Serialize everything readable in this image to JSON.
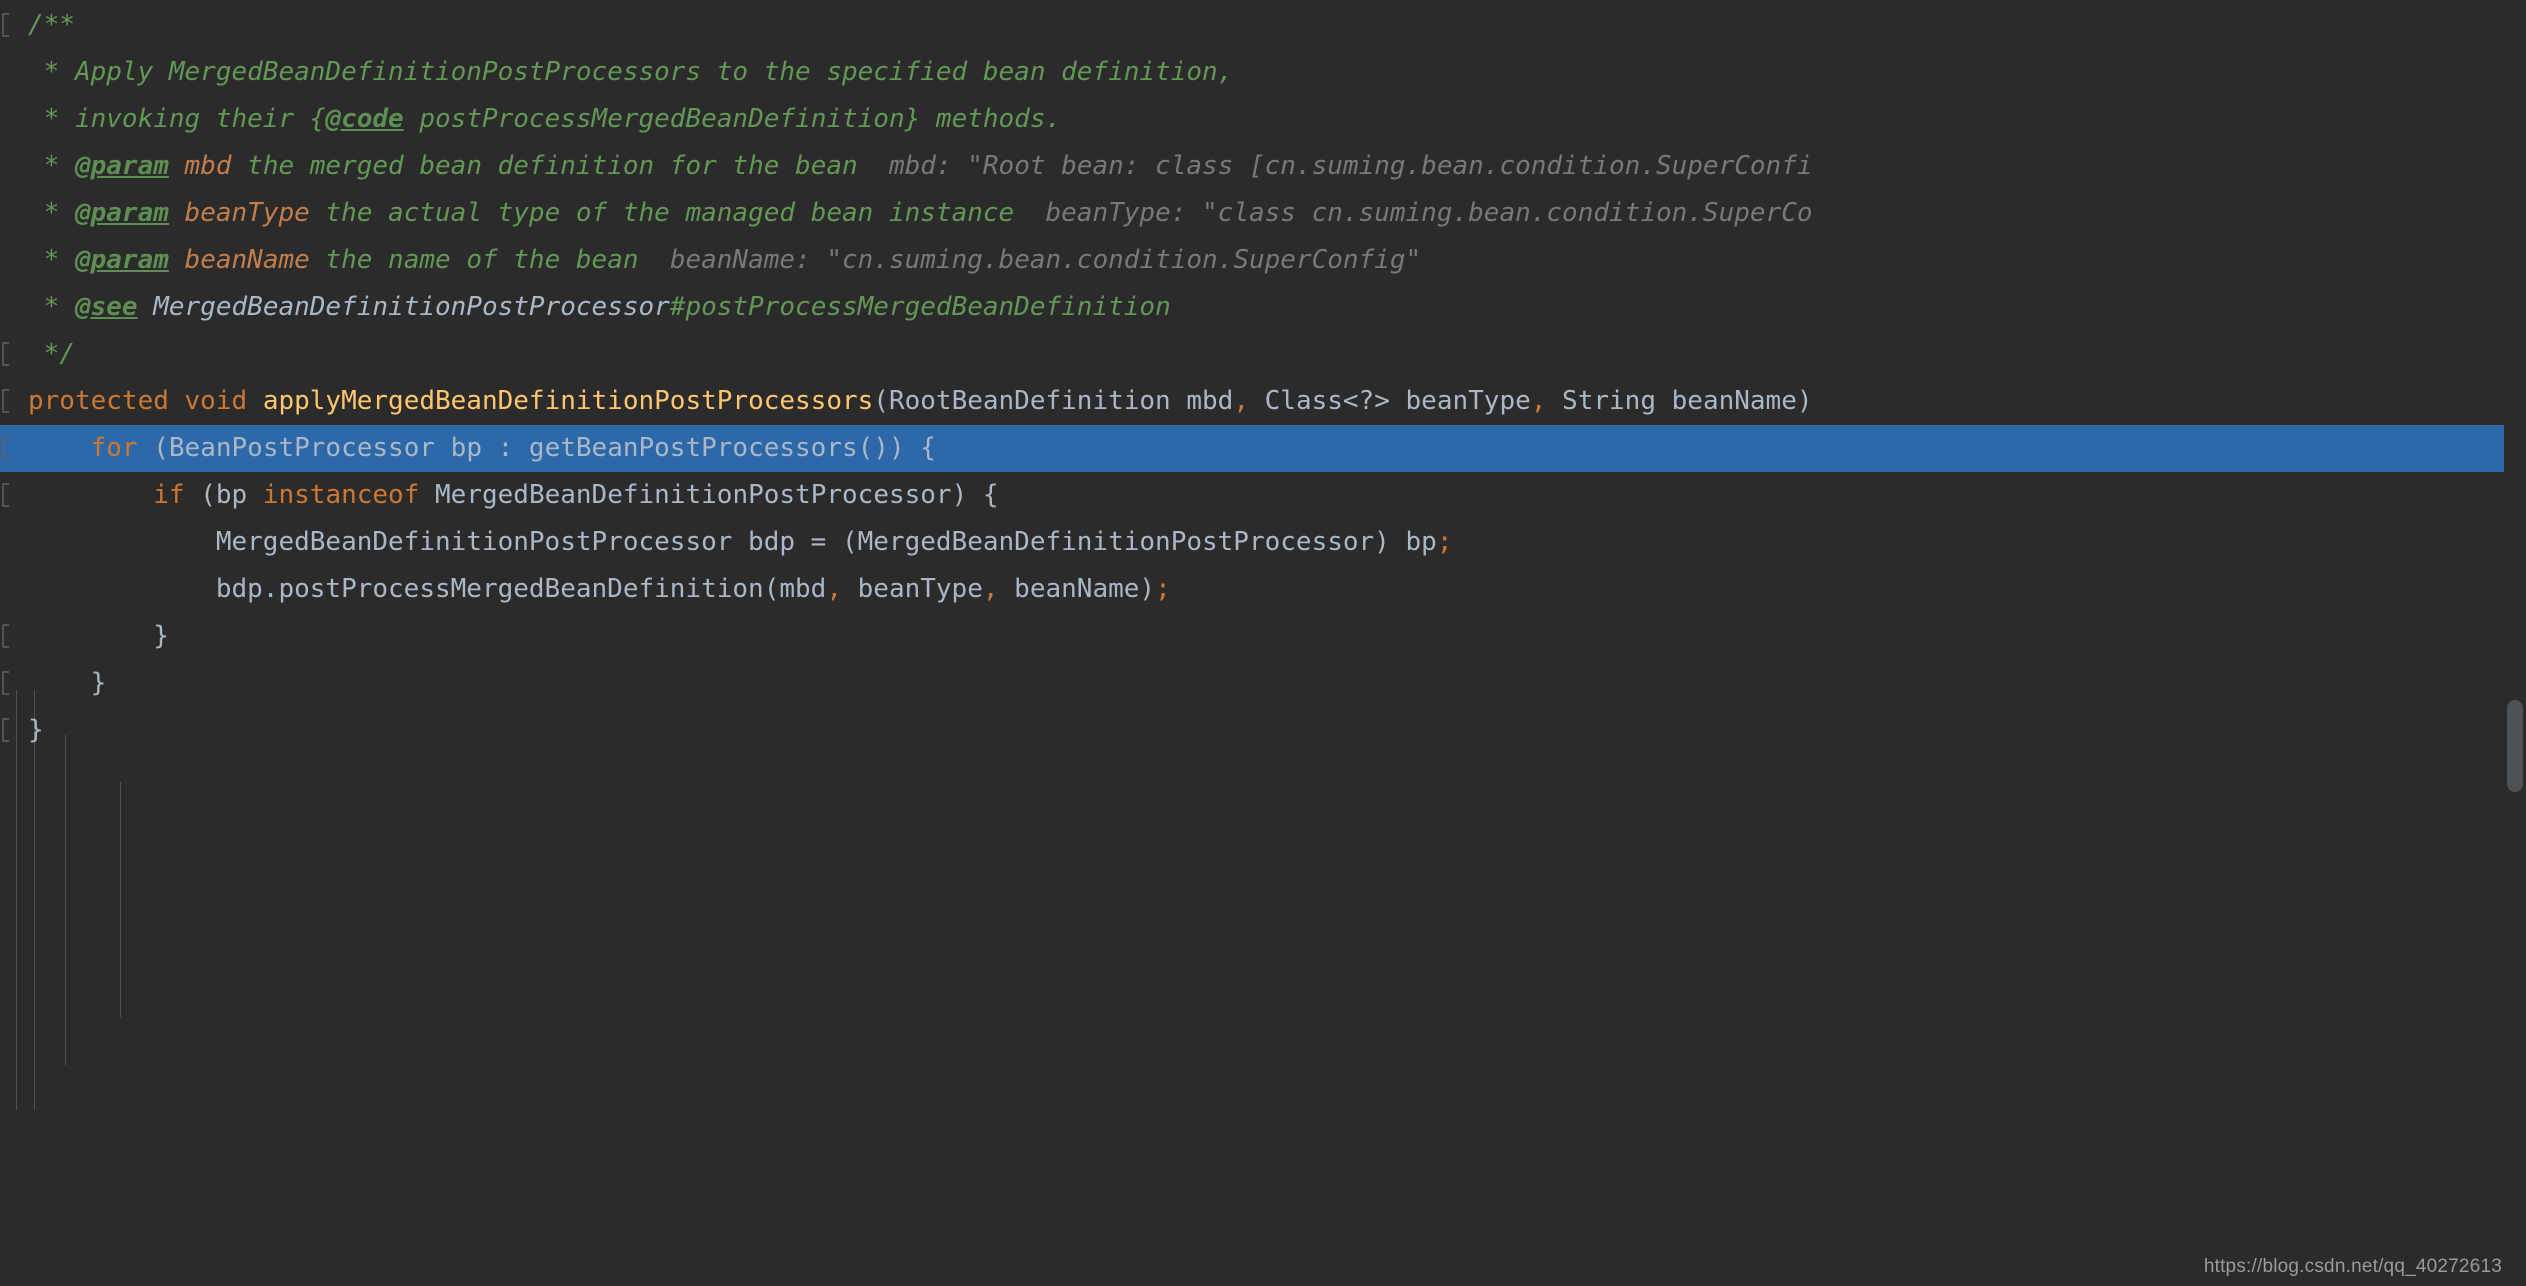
{
  "editor": {
    "theme_name": "darcula",
    "background_color": "#2b2b2b",
    "selection_color": "#2d68a8",
    "indent_guide_color": "#4f5255",
    "default_text_color": "#a9b7c6"
  },
  "watermark": {
    "text": "https://blog.csdn.net/qq_40272613"
  },
  "scrollbar": {
    "thumb_color": "#4e5254"
  },
  "code": {
    "language": "java",
    "lines": [
      {
        "id": "line-1",
        "fold_marker": "fold-end-icon",
        "tokens": [
          {
            "cls": "cmt",
            "text": "/**"
          }
        ]
      },
      {
        "id": "line-2",
        "fold_marker": null,
        "tokens": [
          {
            "cls": "cmt",
            "text": " * Apply MergedBeanDefinitionPostProcessors to the specified bean definition,"
          }
        ]
      },
      {
        "id": "line-3",
        "fold_marker": null,
        "tokens": [
          {
            "cls": "cmt",
            "text": " * invoking their {"
          },
          {
            "cls": "tag",
            "text": "@code"
          },
          {
            "cls": "cmt",
            "text": " postProcessMergedBeanDefinition} methods."
          }
        ]
      },
      {
        "id": "line-4",
        "fold_marker": null,
        "tokens": [
          {
            "cls": "cmt",
            "text": " * "
          },
          {
            "cls": "tag",
            "text": "@param"
          },
          {
            "cls": "cmt",
            "text": " "
          },
          {
            "cls": "pname",
            "text": "mbd"
          },
          {
            "cls": "cmt",
            "text": " the merged bean definition for the bean"
          },
          {
            "cls": "hint",
            "text": "  mbd: \"Root bean: class [cn.suming.bean.condition.SuperConfi"
          }
        ]
      },
      {
        "id": "line-5",
        "fold_marker": null,
        "tokens": [
          {
            "cls": "cmt",
            "text": " * "
          },
          {
            "cls": "tag",
            "text": "@param"
          },
          {
            "cls": "cmt",
            "text": " "
          },
          {
            "cls": "pname",
            "text": "beanType"
          },
          {
            "cls": "cmt",
            "text": " the actual type of the managed bean instance"
          },
          {
            "cls": "hint",
            "text": "  beanType: \"class cn.suming.bean.condition.SuperCo"
          }
        ]
      },
      {
        "id": "line-6",
        "fold_marker": null,
        "tokens": [
          {
            "cls": "cmt",
            "text": " * "
          },
          {
            "cls": "tag",
            "text": "@param"
          },
          {
            "cls": "cmt",
            "text": " "
          },
          {
            "cls": "pname",
            "text": "beanName"
          },
          {
            "cls": "cmt",
            "text": " the name of the bean"
          },
          {
            "cls": "hint",
            "text": "  beanName: \"cn.suming.bean.condition.SuperConfig\""
          }
        ]
      },
      {
        "id": "line-7",
        "fold_marker": null,
        "tokens": [
          {
            "cls": "cmt",
            "text": " * "
          },
          {
            "cls": "tag",
            "text": "@see"
          },
          {
            "cls": "cmt",
            "text": " "
          },
          {
            "cls": "cmtref",
            "text": "MergedBeanDefinitionPostProcessor"
          },
          {
            "cls": "cmtlink",
            "text": "#postProcessMergedBeanDefinition"
          }
        ]
      },
      {
        "id": "line-8",
        "fold_marker": "fold-end-icon",
        "tokens": [
          {
            "cls": "cmt",
            "text": " */"
          }
        ]
      },
      {
        "id": "line-9",
        "fold_marker": "fold-start-icon",
        "tokens": [
          {
            "cls": "kw",
            "text": "protected void "
          },
          {
            "cls": "mname",
            "text": "applyMergedBeanDefinitionPostProcessors"
          },
          {
            "cls": "punc",
            "text": "(RootBeanDefinition mbd"
          },
          {
            "cls": "op",
            "text": ","
          },
          {
            "cls": "punc",
            "text": " Class<?> beanType"
          },
          {
            "cls": "op",
            "text": ","
          },
          {
            "cls": "punc",
            "text": " String beanName)"
          }
        ]
      },
      {
        "id": "line-10",
        "fold_marker": "fold-start-icon",
        "highlighted": true,
        "tokens": [
          {
            "cls": "punc",
            "text": "    "
          },
          {
            "cls": "kw",
            "text": "for"
          },
          {
            "cls": "punc",
            "text": " (BeanPostProcessor bp : getBeanPostProcessors()) {"
          }
        ]
      },
      {
        "id": "line-11",
        "fold_marker": "fold-start-icon",
        "tokens": [
          {
            "cls": "punc",
            "text": "        "
          },
          {
            "cls": "kw",
            "text": "if"
          },
          {
            "cls": "punc",
            "text": " (bp "
          },
          {
            "cls": "kw",
            "text": "instanceof"
          },
          {
            "cls": "punc",
            "text": " MergedBeanDefinitionPostProcessor) {"
          }
        ]
      },
      {
        "id": "line-12",
        "fold_marker": null,
        "tokens": [
          {
            "cls": "punc",
            "text": "            MergedBeanDefinitionPostProcessor bdp = (MergedBeanDefinitionPostProcessor) bp"
          },
          {
            "cls": "op",
            "text": ";"
          }
        ]
      },
      {
        "id": "line-13",
        "fold_marker": null,
        "tokens": [
          {
            "cls": "punc",
            "text": "            bdp.postProcessMergedBeanDefinition(mbd"
          },
          {
            "cls": "op",
            "text": ","
          },
          {
            "cls": "punc",
            "text": " beanType"
          },
          {
            "cls": "op",
            "text": ","
          },
          {
            "cls": "punc",
            "text": " beanName)"
          },
          {
            "cls": "op",
            "text": ";"
          }
        ]
      },
      {
        "id": "line-14",
        "fold_marker": "fold-end-icon",
        "tokens": [
          {
            "cls": "punc",
            "text": "        }"
          }
        ]
      },
      {
        "id": "line-15",
        "fold_marker": "fold-end-icon",
        "tokens": [
          {
            "cls": "punc",
            "text": "    }"
          }
        ]
      },
      {
        "id": "line-16",
        "fold_marker": "fold-end-icon",
        "tokens": [
          {
            "cls": "punc",
            "text": "}"
          }
        ]
      }
    ]
  }
}
